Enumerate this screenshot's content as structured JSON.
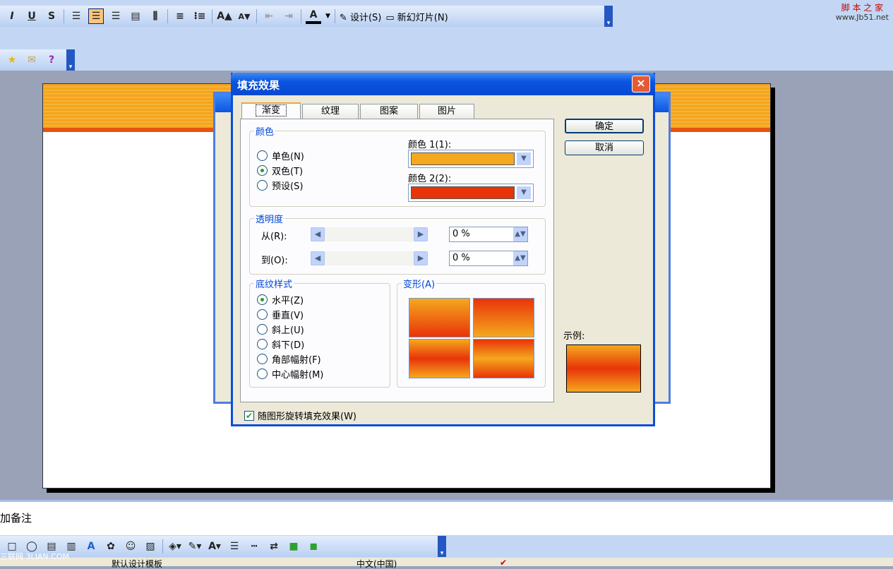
{
  "toolbar": {
    "formatting": [
      "I",
      "U",
      "S",
      "align-left",
      "align-center",
      "align-right",
      "distribute",
      "vertical-text",
      "numbered-list",
      "bullet-list",
      "A▲",
      "A▼",
      "decrease-indent",
      "increase-indent",
      "font-color"
    ],
    "design_label": "设计(S)",
    "new_slide_label": "新幻灯片(N)",
    "help_label": "?"
  },
  "watermark_top": "脚 本 之 家",
  "watermark_url": "www.Jb51.net",
  "watermark_bottom": "三联网 3LIAN.COM",
  "notes": {
    "placeholder": "加备注"
  },
  "status": {
    "template": "默认设计模板",
    "language": "中文(中国)"
  },
  "dialog": {
    "title": "填充效果",
    "close": "×",
    "tabs": [
      {
        "label": "渐变",
        "active": true
      },
      {
        "label": "纹理"
      },
      {
        "label": "图案"
      },
      {
        "label": "图片"
      }
    ],
    "color_group": {
      "label": "颜色",
      "options": [
        {
          "label": "单色(N)",
          "checked": false
        },
        {
          "label": "双色(T)",
          "checked": true
        },
        {
          "label": "预设(S)",
          "checked": false
        }
      ],
      "color1_label": "颜色 1(1):",
      "color1": "#f5a81e",
      "color2_label": "颜色 2(2):",
      "color2": "#e83409"
    },
    "transparency": {
      "label": "透明度",
      "from_label": "从(R):",
      "from_value": "0 %",
      "to_label": "到(O):",
      "to_value": "0 %"
    },
    "shading": {
      "label": "底纹样式",
      "options": [
        {
          "label": "水平(Z)",
          "checked": true
        },
        {
          "label": "垂直(V)",
          "checked": false
        },
        {
          "label": "斜上(U)",
          "checked": false
        },
        {
          "label": "斜下(D)",
          "checked": false
        },
        {
          "label": "角部幅射(F)",
          "checked": false
        },
        {
          "label": "中心幅射(M)",
          "checked": false
        }
      ]
    },
    "variants_label": "变形(A)",
    "ok": "确定",
    "cancel": "取消",
    "sample_label": "示例:",
    "rotate_checkbox": {
      "label": "随图形旋转填充效果(W)",
      "checked": true
    }
  }
}
